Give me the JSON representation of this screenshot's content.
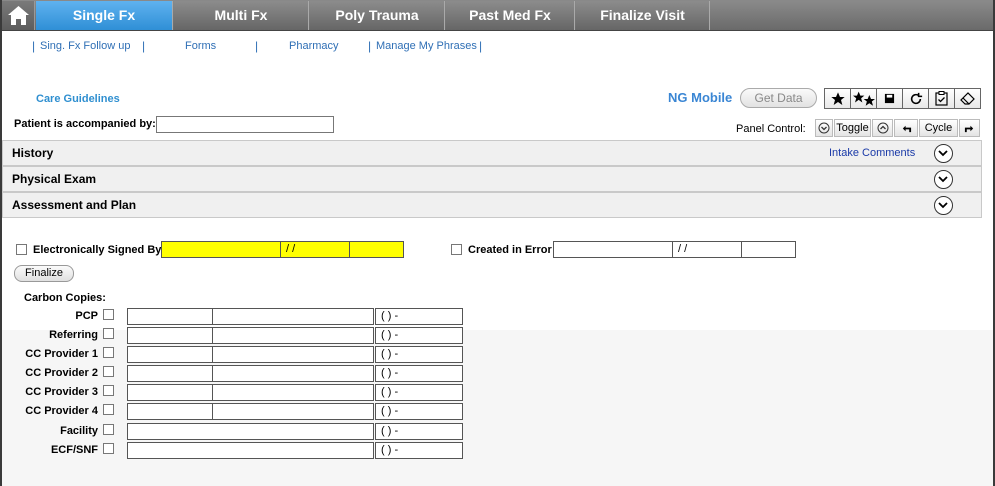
{
  "tabs": [
    {
      "label": "Single Fx",
      "active": true
    },
    {
      "label": "Multi Fx",
      "active": false
    },
    {
      "label": "Poly Trauma",
      "active": false
    },
    {
      "label": "Past Med Fx",
      "active": false
    },
    {
      "label": "Finalize Visit",
      "active": false
    }
  ],
  "subnav": {
    "items": [
      "Sing. Fx Follow up",
      "Forms",
      "Pharmacy",
      "Manage My Phrases"
    ],
    "separator": "|"
  },
  "care_guidelines": "Care Guidelines",
  "accompanied": {
    "label": "Patient is accompanied by:",
    "value": ""
  },
  "ng_mobile": "NG Mobile",
  "get_data": "Get Data",
  "toolbar_icons": [
    "star-icon",
    "two-stars-icon",
    "save-icon",
    "refresh-icon",
    "clipboard-check-icon",
    "eraser-icon"
  ],
  "panel_control": {
    "label": "Panel Control:",
    "toggle": "Toggle",
    "cycle": "Cycle"
  },
  "sections": [
    {
      "title": "History",
      "link": "Intake Comments"
    },
    {
      "title": "Physical Exam",
      "link": ""
    },
    {
      "title": "Assessment and Plan",
      "link": ""
    }
  ],
  "signature": {
    "signed_label": "Electronically Signed By:",
    "date_placeholder": "/ /",
    "error_label": "Created in Error",
    "finalize": "Finalize"
  },
  "carbon_copies": {
    "title": "Carbon Copies:",
    "phone_placeholder": "(   )    -",
    "rows": [
      {
        "label": "PCP",
        "split": true
      },
      {
        "label": "Referring",
        "split": true
      },
      {
        "label": "CC Provider 1",
        "split": true
      },
      {
        "label": "CC Provider 2",
        "split": true
      },
      {
        "label": "CC Provider 3",
        "split": true
      },
      {
        "label": "CC Provider 4",
        "split": true
      },
      {
        "label": "Facility",
        "split": false
      },
      {
        "label": "ECF/SNF",
        "split": false
      }
    ]
  },
  "colors": {
    "active_tab": "#3a9be3",
    "signed_field": "#ffff00",
    "link": "#2f6fb5"
  }
}
